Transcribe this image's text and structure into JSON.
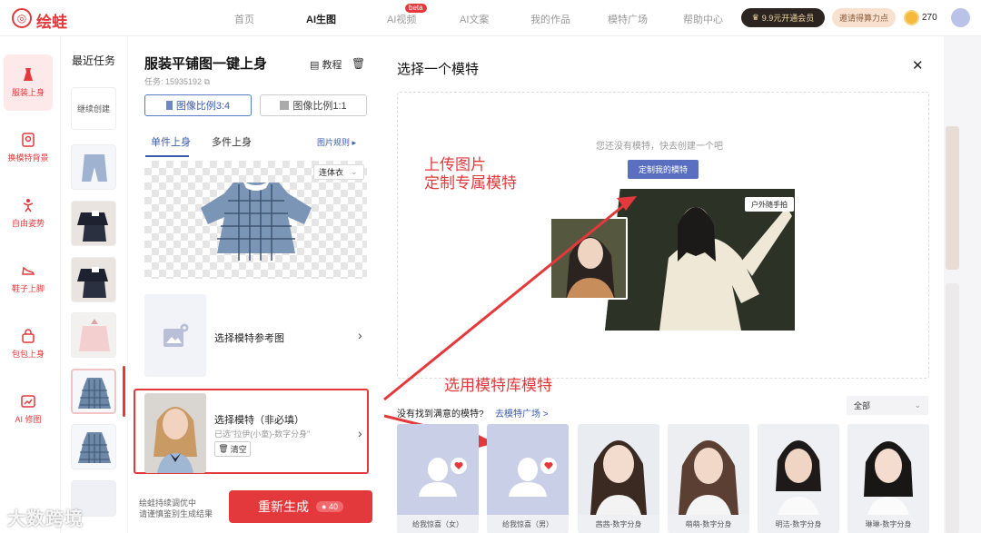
{
  "header": {
    "logo_text": "绘蛙",
    "nav": [
      {
        "label": "首页"
      },
      {
        "label": "AI生图"
      },
      {
        "label": "AI视频"
      },
      {
        "label": "AI文案"
      },
      {
        "label": "我的作品"
      },
      {
        "label": "模特广场"
      },
      {
        "label": "帮助中心"
      }
    ],
    "beta_badge": "beta",
    "vip_label": "9.9元开通会员",
    "invite_label": "邀请得算力点",
    "coins": "270"
  },
  "left_nav": [
    {
      "label": "服装上身",
      "icon": "dress-icon"
    },
    {
      "label": "换模特背景",
      "icon": "portrait-icon"
    },
    {
      "label": "自由姿势",
      "icon": "pose-icon"
    },
    {
      "label": "鞋子上脚",
      "icon": "shoe-icon"
    },
    {
      "label": "包包上身",
      "icon": "bag-icon"
    },
    {
      "label": "AI 修图",
      "icon": "photo-edit-icon"
    }
  ],
  "recent": {
    "title": "最近任务",
    "continue_label": "继续创建"
  },
  "config": {
    "title": "服装平铺图一键上身",
    "task_id": "任务: 15935192",
    "tutorial": "教程",
    "ratio_a": "图像比例3:4",
    "ratio_b": "图像比例1:1",
    "tab_single": "单件上身",
    "tab_multi": "多件上身",
    "rules": "图片规则",
    "garment_type": "连体衣",
    "ref_label": "选择模特参考图",
    "model_label": "选择模特（非必填）",
    "model_sub": "已选\"拉伊(小童)-数字分身\"",
    "clear_label": "清空",
    "footer_line1": "绘蛙持续调优中",
    "footer_line2": "请谨慎鉴别生成结果",
    "regen_label": "重新生成",
    "regen_cost": "40"
  },
  "modal": {
    "title": "选择一个模特",
    "empty_text": "您还没有模特，快去创建一个吧",
    "create_label": "定制我的模特",
    "sample_tag": "户外随手拍",
    "annotation_upload_line1": "上传图片",
    "annotation_upload_line2": "定制专属模特",
    "annotation_library": "选用模特库模特",
    "not_found": "没有找到满意的模特?",
    "goto_plaza": "去模特广场 >",
    "filter_label": "全部",
    "cards": [
      {
        "caption": "给我惊喜（女）"
      },
      {
        "caption": "给我惊喜（男）"
      },
      {
        "caption": "茜茜-数字分身"
      },
      {
        "caption": "萌萌-数字分身"
      },
      {
        "caption": "明洁-数字分身"
      },
      {
        "caption": "琳琳-数字分身"
      }
    ]
  },
  "watermark": "大数跨境",
  "colors": {
    "brand_red": "#e4393c",
    "accent_blue": "#3a5bb0",
    "annotation_red": "#e4393c"
  }
}
